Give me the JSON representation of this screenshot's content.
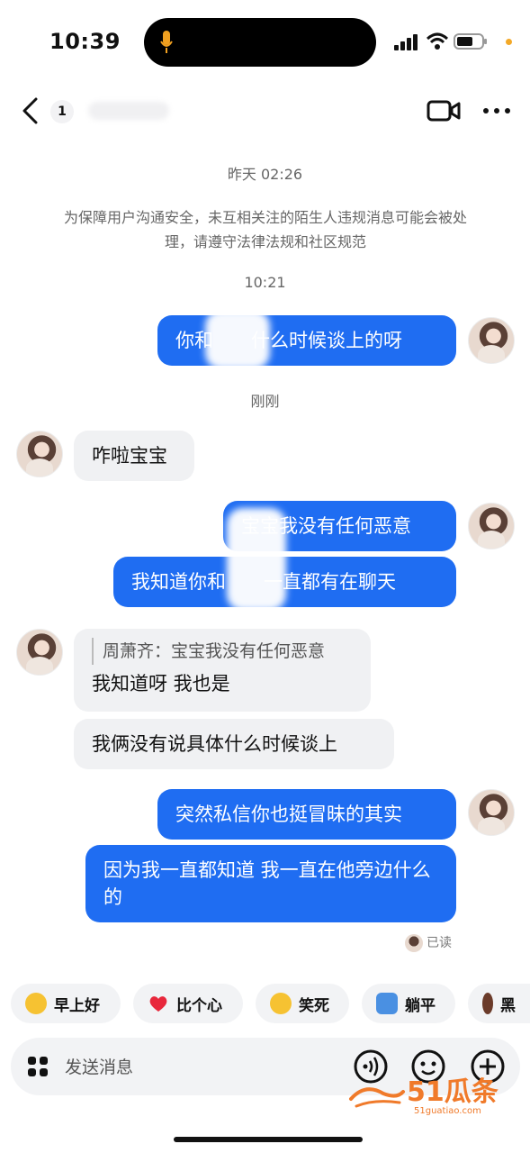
{
  "status_bar": {
    "time": "10:39"
  },
  "nav": {
    "unread_count": "1"
  },
  "chat": {
    "timestamp_1": "昨天 02:26",
    "notice": "为保障用户沟通安全，未互相关注的陌生人违规消息可能会被处理，请遵守法律法规和社区规范",
    "timestamp_2": "10:21",
    "timestamp_3": "刚刚",
    "messages": [
      {
        "side": "out",
        "text": "你和　　什么时候谈上的呀"
      },
      {
        "side": "in",
        "text": "咋啦宝宝"
      },
      {
        "side": "out",
        "text": "宝宝我没有任何恶意"
      },
      {
        "side": "out",
        "text": "我知道你和　　一直都有在聊天"
      },
      {
        "side": "in",
        "quote": "周萧齐：宝宝我没有任何恶意",
        "text": "我知道呀 我也是"
      },
      {
        "side": "in",
        "text": "我俩没有说具体什么时候谈上"
      },
      {
        "side": "out",
        "text": "突然私信你也挺冒昧的其实"
      },
      {
        "side": "out",
        "text": "因为我一直都知道 我一直在他旁边什么的"
      }
    ],
    "read_status": "已读"
  },
  "quick_replies": [
    {
      "label": "早上好",
      "icon": "sunglasses-emoji-icon",
      "color": "#f6c232"
    },
    {
      "label": "比个心",
      "icon": "red-heart-icon",
      "color": "#e8283c"
    },
    {
      "label": "笑死",
      "icon": "laughing-emoji-icon",
      "color": "#f6c232"
    },
    {
      "label": "躺平",
      "icon": "lying-flat-emoji-icon",
      "color": "#4a90e2"
    },
    {
      "label": "黑",
      "icon": "dark-emoji-icon",
      "color": "#6b3b2a"
    }
  ],
  "input": {
    "placeholder": "发送消息"
  },
  "watermark": {
    "brand": "51瓜条",
    "url": "51guatiao.com"
  },
  "colors": {
    "accent": "#1f6df2",
    "incoming_bubble": "#f0f1f3"
  }
}
